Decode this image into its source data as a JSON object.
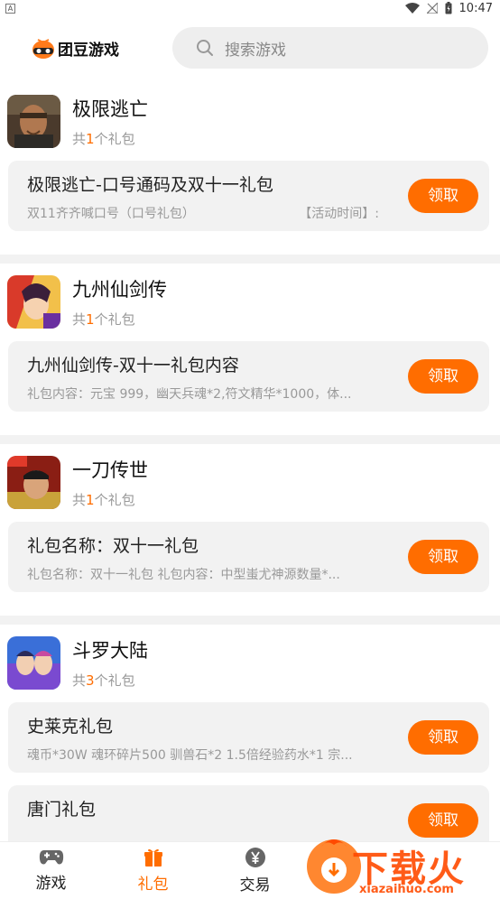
{
  "status_bar": {
    "left_badge": "A",
    "time": "10:47"
  },
  "header": {
    "logo_text": "团豆游戏",
    "search_placeholder": "搜索游戏"
  },
  "games": [
    {
      "name": "极限逃亡",
      "count_prefix": "共",
      "count": "1",
      "count_suffix": "个礼包",
      "gifts": [
        {
          "title": "极限逃亡-口号通码及双十一礼包",
          "desc_left": "双11齐齐喊口号（口号礼包）",
          "desc_right": "【活动时间】:",
          "button": "领取"
        }
      ]
    },
    {
      "name": "九州仙剑传",
      "count_prefix": "共",
      "count": "1",
      "count_suffix": "个礼包",
      "gifts": [
        {
          "title": "九州仙剑传-双十一礼包内容",
          "desc": "礼包内容：元宝 999，幽天兵魂*2,符文精华*1000，体...",
          "button": "领取"
        }
      ]
    },
    {
      "name": "一刀传世",
      "count_prefix": "共",
      "count": "1",
      "count_suffix": "个礼包",
      "gifts": [
        {
          "title": "礼包名称：双十一礼包",
          "desc": "礼包名称：双十一礼包 礼包内容：中型蚩尤神源数量*...",
          "button": "领取"
        }
      ]
    },
    {
      "name": "斗罗大陆",
      "count_prefix": "共",
      "count": "3",
      "count_suffix": "个礼包",
      "gifts": [
        {
          "title": "史莱克礼包",
          "desc": "魂币*30W 魂环碎片500 驯兽石*2 1.5倍经验药水*1 宗...",
          "button": "领取"
        },
        {
          "title": "唐门礼包",
          "desc": "",
          "button": "领取"
        }
      ]
    }
  ],
  "tabbar": {
    "tabs": [
      {
        "label": "游戏",
        "icon": "gamepad-icon"
      },
      {
        "label": "礼包",
        "icon": "gift-icon",
        "active": true
      },
      {
        "label": "交易",
        "icon": "yen-icon"
      }
    ]
  },
  "watermark": {
    "text": "下载火",
    "url": "xiazaihuo.com"
  },
  "colors": {
    "accent": "#ff6d00",
    "card_bg": "#f2f2f2"
  }
}
